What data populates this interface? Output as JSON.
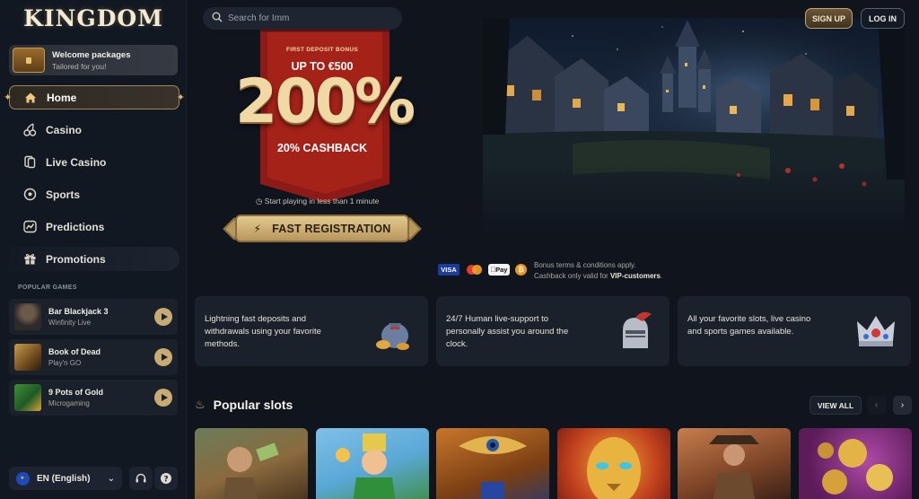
{
  "brand": {
    "logo_text": "KINGDOM"
  },
  "welcome": {
    "title": "Welcome packages",
    "subtitle": "Tailored for you!"
  },
  "nav": {
    "items": [
      {
        "label": "Home",
        "icon": "home-icon",
        "active": true
      },
      {
        "label": "Casino",
        "icon": "cherries-icon"
      },
      {
        "label": "Live Casino",
        "icon": "cards-icon"
      },
      {
        "label": "Sports",
        "icon": "soccer-ball-icon"
      },
      {
        "label": "Predictions",
        "icon": "trend-chart-icon"
      },
      {
        "label": "Promotions",
        "icon": "gift-icon"
      }
    ]
  },
  "popular_games": {
    "title": "POPULAR GAMES",
    "items": [
      {
        "name": "Bar Blackjack 3",
        "provider": "Winfinity Live"
      },
      {
        "name": "Book of Dead",
        "provider": "Play'n GO"
      },
      {
        "name": "9 Pots of Gold",
        "provider": "Microgaming"
      }
    ]
  },
  "footer": {
    "language": "EN (English)"
  },
  "search": {
    "placeholder": "Search for Imm"
  },
  "header": {
    "signup": "SIGN UP",
    "login": "LOG IN"
  },
  "hero": {
    "small": "FIRST DEPOSIT BONUS",
    "up_to": "UP TO €500",
    "percent": "200%",
    "cashback": "20% CASHBACK",
    "start": "Start playing in less than 1 minute",
    "cta": "FAST REGISTRATION"
  },
  "payments": {
    "methods": [
      "VISA",
      "Mastercard",
      "Apple Pay",
      "Bitcoin"
    ],
    "apple_label": "Pay",
    "terms_line1": "Bonus terms & conditions apply.",
    "terms_line2_prefix": "Cashback only valid for ",
    "terms_line2_bold": "VIP-customers",
    "terms_line2_suffix": "."
  },
  "features": [
    {
      "text": "Lightning fast deposits and withdrawals using your favorite methods."
    },
    {
      "text": "24/7 Human live-support to personally assist you around the clock."
    },
    {
      "text": "All your favorite slots, live casino and sports games available."
    }
  ],
  "popular_slots": {
    "title": "Popular slots",
    "view_all": "VIEW ALL"
  },
  "colors": {
    "accent_gold": "#c7ab72",
    "background": "#0f141d",
    "banner_red": "#8c1a16"
  }
}
